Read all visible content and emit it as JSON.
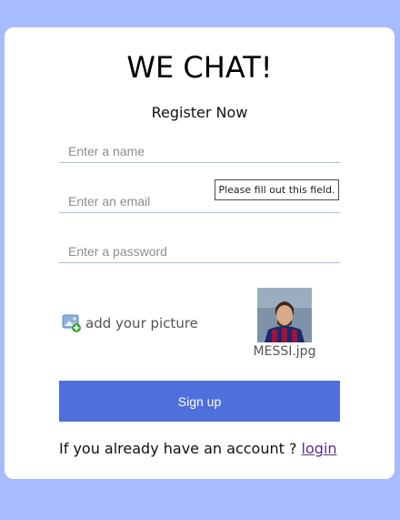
{
  "header": {
    "title": "WE CHAT!",
    "subtitle": "Register Now"
  },
  "form": {
    "name_placeholder": "Enter a name",
    "email_placeholder": "Enter an email",
    "password_placeholder": "Enter a password",
    "validation_tooltip": "Please fill out this field.",
    "add_picture_label": "add your picture",
    "add_picture_icon": "image-add-icon",
    "selected_file_name": "MESSI.jpg",
    "submit_label": "Sign up"
  },
  "footer": {
    "prompt_text": "If you already have an account ? ",
    "login_link": "login"
  },
  "colors": {
    "page_background": "#a7bbff",
    "card_background": "#ffffff",
    "button_background": "#4f6fdb",
    "input_underline": "#a9c1dd",
    "link_color": "#5a2e8c"
  }
}
